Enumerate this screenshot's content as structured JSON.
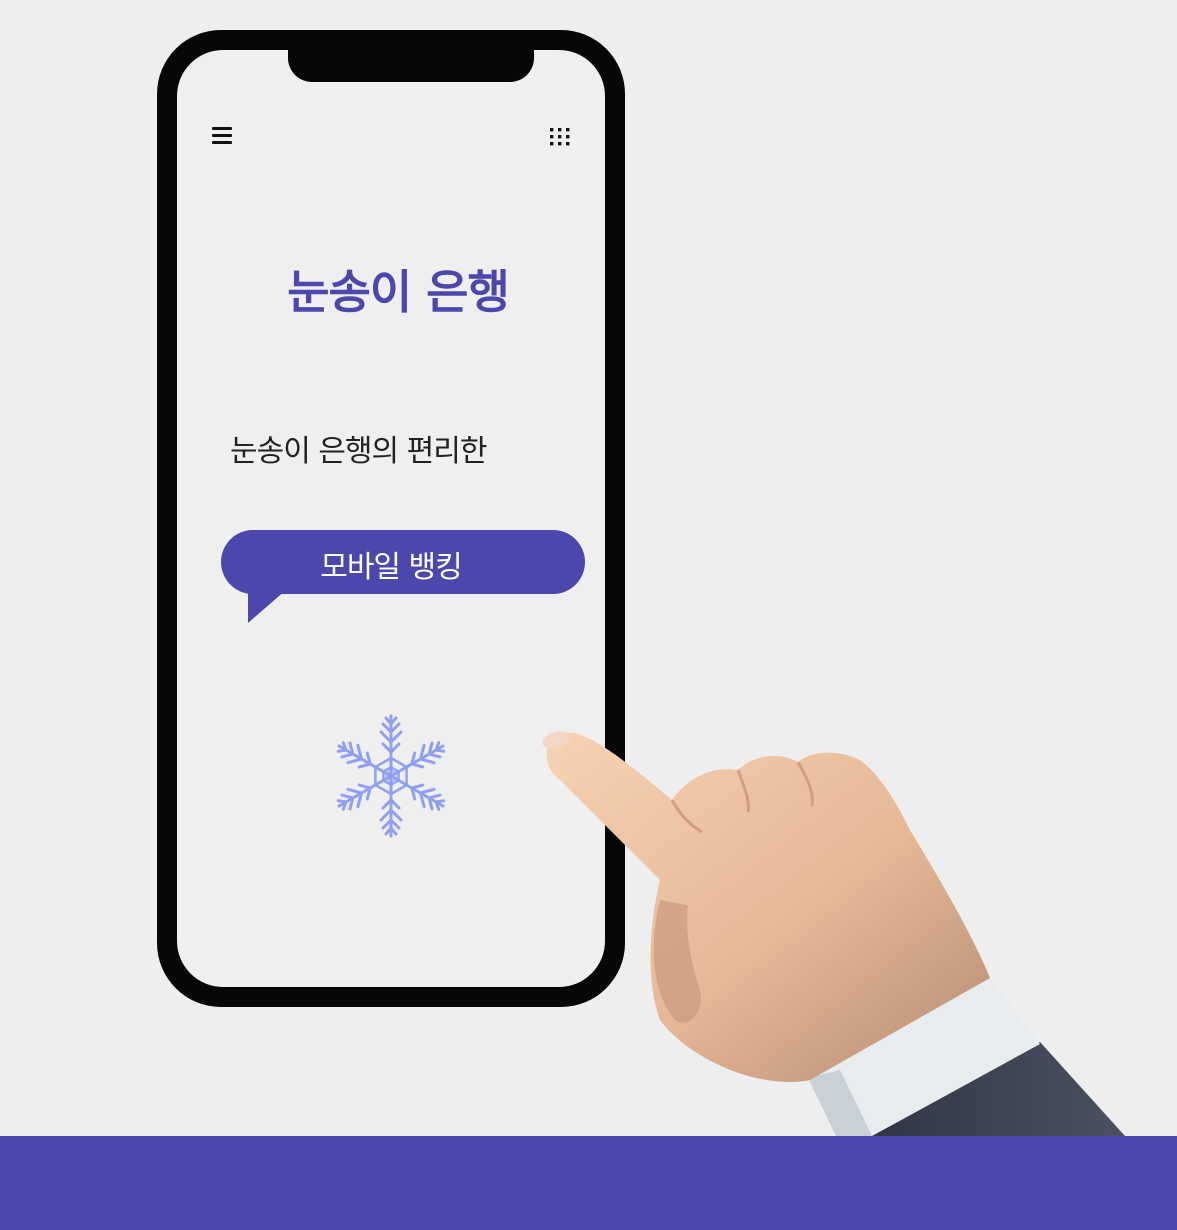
{
  "header": {
    "menu_icon": "hamburger-menu-icon",
    "apps_icon": "grid-apps-icon"
  },
  "main": {
    "title": "눈송이 은행",
    "tagline": "눈송이 은행의 편리한",
    "cta_label": "모바일 뱅킹",
    "illustration_icon": "snowflake-icon"
  },
  "colors": {
    "brand": "#4b47ad",
    "background": "#eeeeee",
    "snowflake": "#8fa0f0"
  }
}
